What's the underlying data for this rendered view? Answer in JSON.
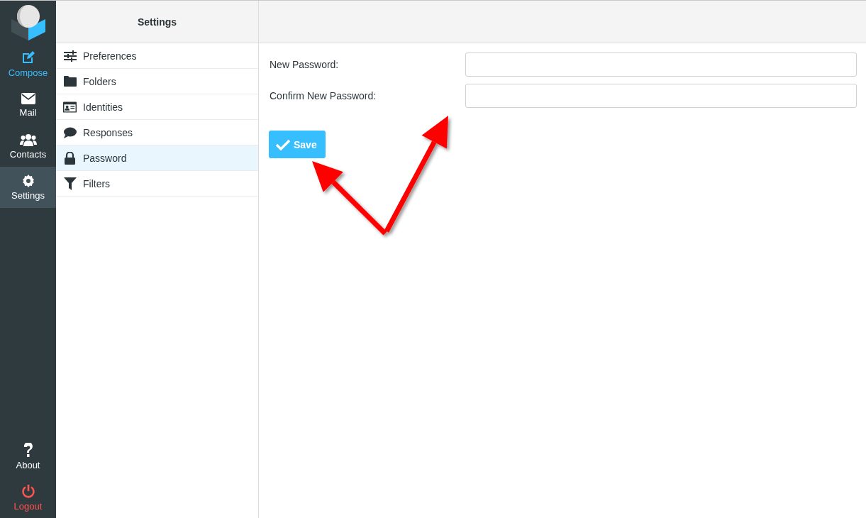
{
  "nav": {
    "items": [
      {
        "label": "Compose",
        "kind": "primary",
        "selected": false
      },
      {
        "label": "Mail",
        "kind": "normal",
        "selected": false
      },
      {
        "label": "Contacts",
        "kind": "normal",
        "selected": false
      },
      {
        "label": "Settings",
        "kind": "normal",
        "selected": true
      }
    ],
    "footer_items": [
      {
        "label": "About",
        "kind": "normal"
      },
      {
        "label": "Logout",
        "kind": "danger"
      }
    ]
  },
  "settings_list": {
    "title": "Settings",
    "items": [
      {
        "label": "Preferences",
        "selected": false
      },
      {
        "label": "Folders",
        "selected": false
      },
      {
        "label": "Identities",
        "selected": false
      },
      {
        "label": "Responses",
        "selected": false
      },
      {
        "label": "Password",
        "selected": true
      },
      {
        "label": "Filters",
        "selected": false
      }
    ]
  },
  "password_form": {
    "fields": [
      {
        "label": "New Password:"
      },
      {
        "label": "Confirm New Password:"
      }
    ],
    "save_button": "Save"
  },
  "annotations": [
    {
      "kind": "arrow"
    },
    {
      "kind": "arrow"
    }
  ]
}
